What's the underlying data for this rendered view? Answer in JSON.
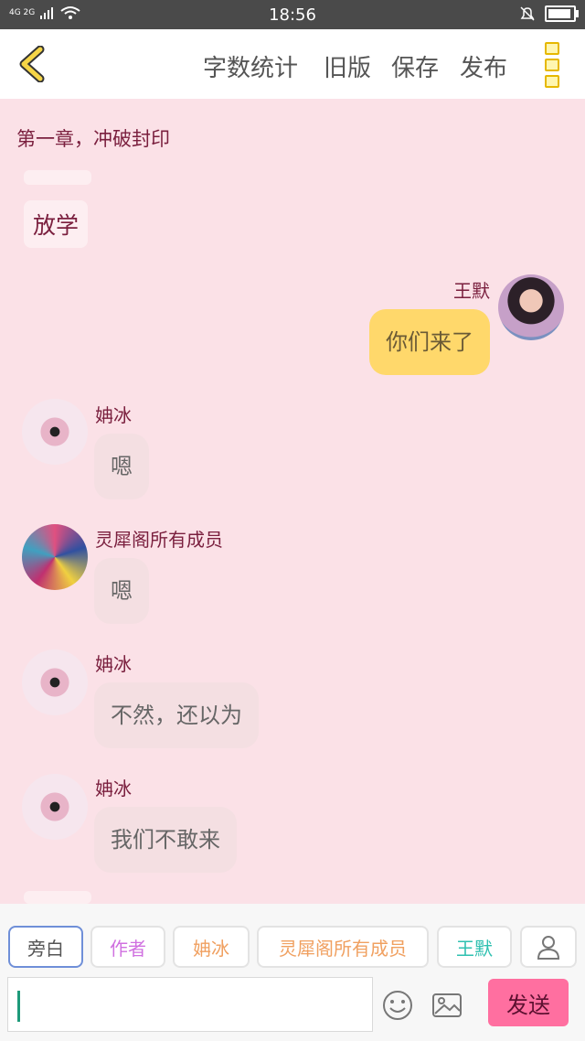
{
  "status_bar": {
    "network": "4G 2G",
    "time": "18:56"
  },
  "topbar": {
    "word_count": "字数统计",
    "old_version": "旧版",
    "save": "保存",
    "publish": "发布"
  },
  "chapter_title": "第一章，冲破封印",
  "narration": "放学",
  "messages": [
    {
      "name": "王默",
      "text": "你们来了",
      "side": "right"
    },
    {
      "name": "姌冰",
      "text": "嗯",
      "side": "left"
    },
    {
      "name": "灵犀阁所有成员",
      "text": "嗯",
      "side": "left"
    },
    {
      "name": "姌冰",
      "text": "不然，还以为",
      "side": "left"
    },
    {
      "name": "姌冰",
      "text": "我们不敢来",
      "side": "left"
    }
  ],
  "roles": [
    {
      "label": "旁白",
      "color": "#555555"
    },
    {
      "label": "作者",
      "color": "#d070e0"
    },
    {
      "label": "姌冰",
      "color": "#f0a060"
    },
    {
      "label": "灵犀阁所有成员",
      "color": "#f0a060"
    },
    {
      "label": "王默",
      "color": "#2ec0b0"
    }
  ],
  "send_label": "发送",
  "colors": {
    "background": "#fbe1e7",
    "accent": "#ff6fa0",
    "own_bubble": "#ffd86b"
  }
}
